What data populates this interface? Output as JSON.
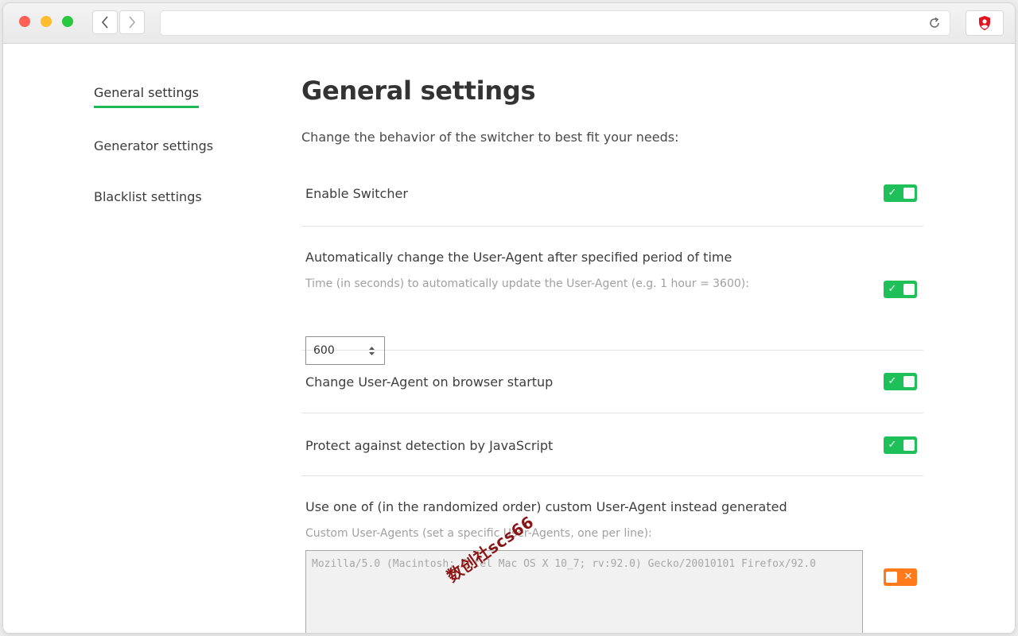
{
  "nav": {
    "items": [
      {
        "label": "General settings",
        "active": true
      },
      {
        "label": "Generator settings",
        "active": false
      },
      {
        "label": "Blacklist settings",
        "active": false
      }
    ]
  },
  "main": {
    "title": "General settings",
    "subtitle": "Change the behavior of the switcher to best fit your needs:",
    "settings": [
      {
        "label": "Enable Switcher",
        "enabled": true
      },
      {
        "label": "Automatically change the User-Agent after specified period of time",
        "hint": "Time (in seconds) to automatically update the User-Agent (e.g. 1 hour = 3600):",
        "value": "600",
        "enabled": true
      },
      {
        "label": "Change User-Agent on browser startup",
        "enabled": true
      },
      {
        "label": "Protect against detection by JavaScript",
        "enabled": true
      },
      {
        "label": "Use one of (in the randomized order) custom User-Agent instead generated",
        "hint": "Custom User-Agents (set a specific User-Agents, one per line):",
        "placeholder": "Mozilla/5.0 (Macintosh; Intel Mac OS X 10_7; rv:92.0) Gecko/20010101 Firefox/92.0",
        "enabled": false
      }
    ]
  },
  "toggle_glyphs": {
    "on": "✓",
    "off": "✕"
  },
  "colors": {
    "accent": "#1db954",
    "toggle_on": "#1fc05a",
    "toggle_off": "#ff7a1a",
    "extension_icon": "#e0141e"
  },
  "watermark": "数创社scs66"
}
